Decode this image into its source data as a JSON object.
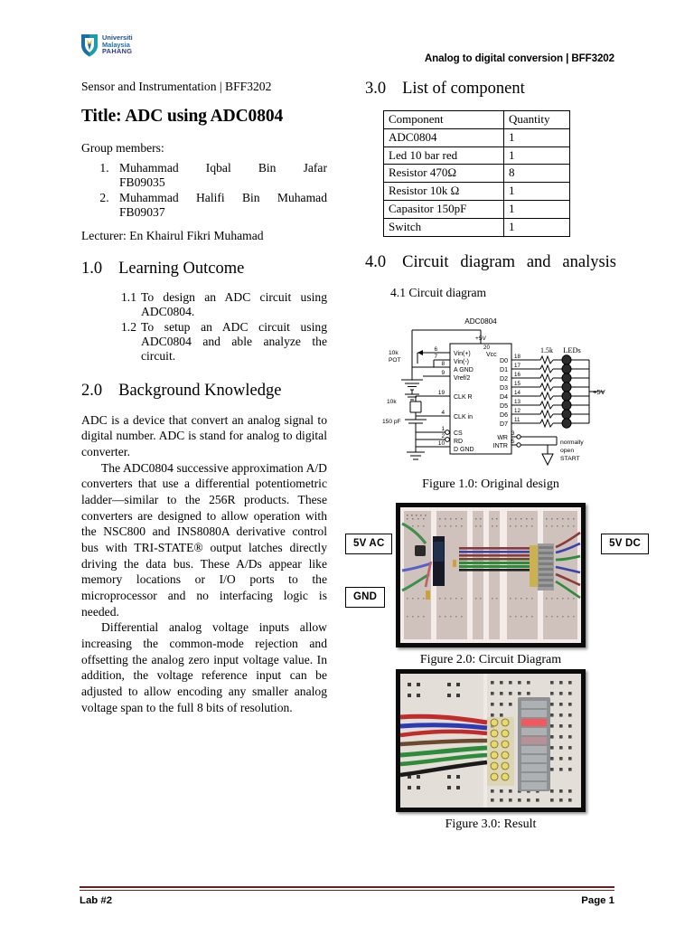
{
  "header": {
    "logo_lines": [
      "Universiti",
      "Malaysia",
      "PAHANG"
    ],
    "logo_icon": "shield-icon",
    "title": "Analog to digital conversion | BFF3202"
  },
  "left_column": {
    "course_line": "Sensor and Instrumentation | BFF3202",
    "doc_title": "Title: ADC using ADC0804",
    "group_label": "Group members:",
    "members": [
      {
        "name": "Muhammad Iqbal Bin Jafar",
        "id": "FB09035"
      },
      {
        "name": "Muhammad Halifi Bin Muhamad",
        "id": "FB09037"
      }
    ],
    "lecturer": "Lecturer: En Khairul Fikri Muhamad",
    "section1": {
      "num": "1.0",
      "title": "Learning Outcome",
      "items": [
        {
          "num": "1.1",
          "text": "To design an ADC circuit using ADC0804."
        },
        {
          "num": "1.2",
          "text": "To setup an ADC circuit using ADC0804 and able analyze the circuit."
        }
      ]
    },
    "section2": {
      "num": "2.0",
      "title": "Background Knowledge",
      "paragraphs": [
        "ADC is a device that convert an analog signal to digital number. ADC is stand for analog to digital converter.",
        "The ADC0804 successive approximation A/D converters that use a differential potentiometric ladder—similar to the 256R products. These converters are designed to allow operation with the NSC800 and INS8080A derivative control bus with TRI-STATE® output latches directly driving the data bus. These A/Ds appear like memory locations or I/O ports to the microprocessor and no interfacing logic is needed.",
        "Differential analog voltage inputs allow increasing the common-mode rejection and offsetting the analog zero input voltage value. In addition, the voltage reference input can be adjusted to allow encoding any smaller analog voltage span to the full 8 bits of resolution."
      ]
    }
  },
  "right_column": {
    "section3": {
      "num": "3.0",
      "title": "List of component",
      "table": {
        "headers": [
          "Component",
          "Quantity"
        ],
        "rows": [
          [
            "ADC0804",
            "1"
          ],
          [
            "Led 10 bar red",
            "1"
          ],
          [
            "Resistor 470Ω",
            "8"
          ],
          [
            "Resistor 10k Ω",
            "1"
          ],
          [
            "Capasitor 150pF",
            "1"
          ],
          [
            "Switch",
            "1"
          ]
        ]
      }
    },
    "section4": {
      "num": "4.0",
      "title": "Circuit diagram and analysis",
      "sub_head": "4.1 Circuit diagram"
    },
    "schematic": {
      "chip_label": "ADC0804",
      "supply_label": "+5V",
      "vcc_pin": "20",
      "vcc_label": "Vcc",
      "pot_label_1": "10k",
      "pot_label_2": "POT",
      "rc_res_label": "10k",
      "rc_cap_label": "150 pF",
      "left_pins": [
        {
          "pin": "6",
          "label": "Vin(+)"
        },
        {
          "pin": "7",
          "label": "Vin(-)"
        },
        {
          "pin": "8",
          "label": "A GND"
        },
        {
          "pin": "9",
          "label": "Vref/2"
        },
        {
          "pin": "19",
          "label": "CLK R"
        },
        {
          "pin": "4",
          "label": "CLK in"
        },
        {
          "pin": "1",
          "label": "CS"
        },
        {
          "pin": "2",
          "label": "RD"
        },
        {
          "pin": "10",
          "label": "D GND"
        }
      ],
      "data_pins": [
        {
          "pin": "18",
          "label": "D0"
        },
        {
          "pin": "17",
          "label": "D1"
        },
        {
          "pin": "16",
          "label": "D2"
        },
        {
          "pin": "15",
          "label": "D3"
        },
        {
          "pin": "14",
          "label": "D4"
        },
        {
          "pin": "13",
          "label": "D5"
        },
        {
          "pin": "12",
          "label": "D6"
        },
        {
          "pin": "11",
          "label": "D7"
        }
      ],
      "resistor_label": "1.5k",
      "leds_label": "LEDs",
      "led_supply_label": "+5V",
      "ctrl_pins": [
        {
          "pin": "3",
          "label": "WR"
        },
        {
          "pin": "5",
          "label": "INTR"
        }
      ],
      "switch_label_lines": [
        "normally",
        "open",
        "START"
      ]
    },
    "figures": [
      {
        "caption": "Figure 1.0: Original design"
      },
      {
        "caption": "Figure 2.0: Circuit Diagram"
      },
      {
        "caption": "Figure 3.0: Result"
      }
    ],
    "photo_tags": {
      "ac": "5V AC",
      "gnd": "GND",
      "dc": "5V DC"
    }
  },
  "footer": {
    "left": "Lab #2",
    "right": "Page 1",
    "rule_color": "#6b2020"
  }
}
